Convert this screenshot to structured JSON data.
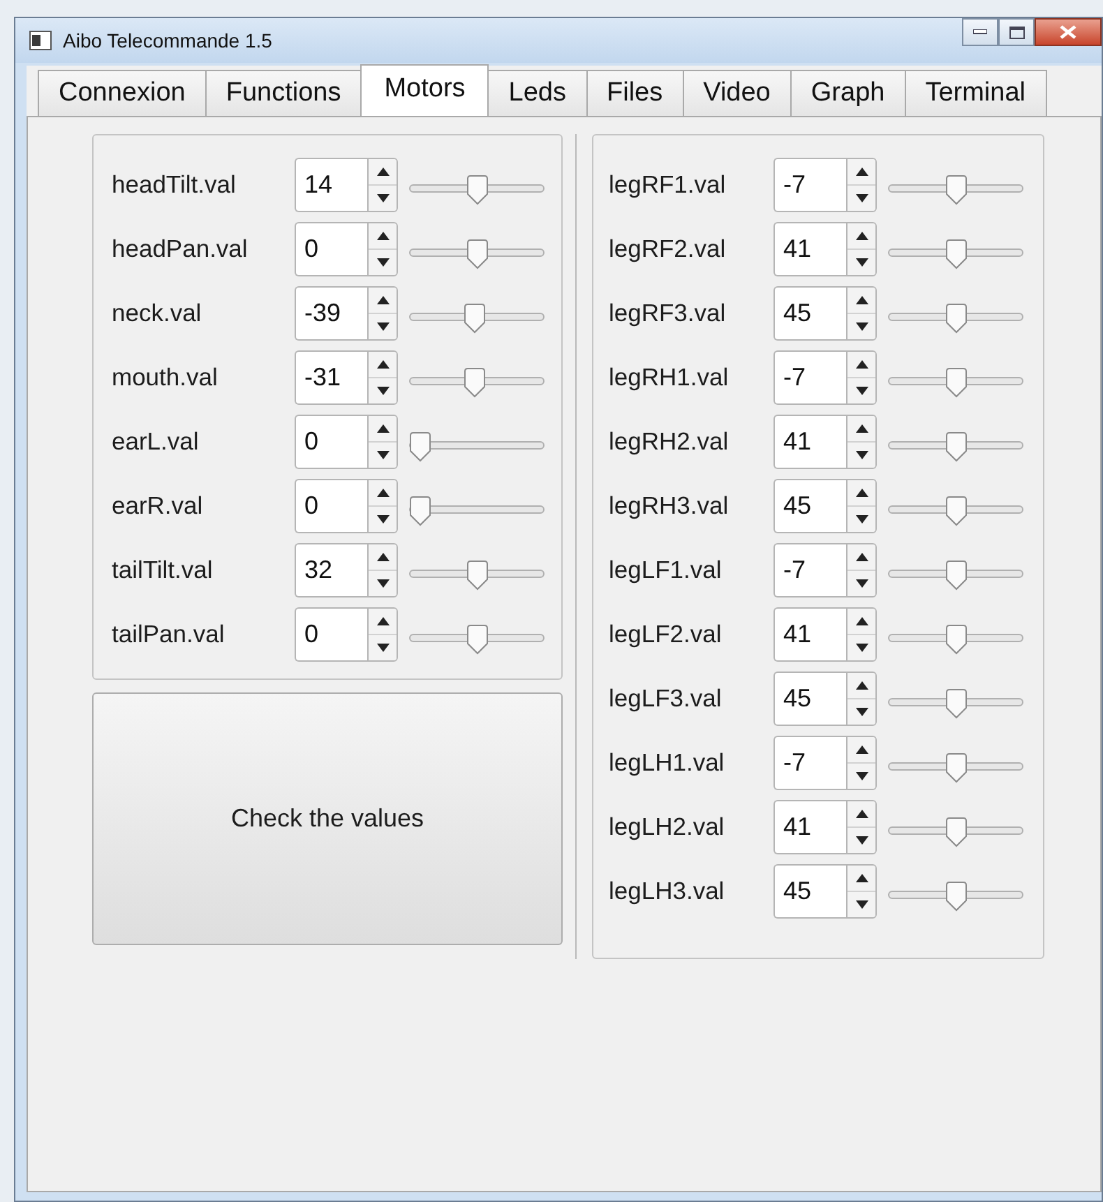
{
  "window": {
    "title": "Aibo Telecommande 1.5"
  },
  "tabs": [
    {
      "label": "Connexion",
      "selected": false
    },
    {
      "label": "Functions",
      "selected": false
    },
    {
      "label": "Motors",
      "selected": true
    },
    {
      "label": "Leds",
      "selected": false
    },
    {
      "label": "Files",
      "selected": false
    },
    {
      "label": "Video",
      "selected": false
    },
    {
      "label": "Graph",
      "selected": false
    },
    {
      "label": "Terminal",
      "selected": false
    }
  ],
  "head_motors": [
    {
      "label": "headTilt.val",
      "value": "14",
      "level": 0.5
    },
    {
      "label": "headPan.val",
      "value": "0",
      "level": 0.5
    },
    {
      "label": "neck.val",
      "value": "-39",
      "level": 0.48
    },
    {
      "label": "mouth.val",
      "value": "-31",
      "level": 0.48
    },
    {
      "label": "earL.val",
      "value": "0",
      "level": 0
    },
    {
      "label": "earR.val",
      "value": "0",
      "level": 0
    },
    {
      "label": "tailTilt.val",
      "value": "32",
      "level": 0.5
    },
    {
      "label": "tailPan.val",
      "value": "0",
      "level": 0.5
    }
  ],
  "check_button": {
    "label": "Check the values"
  },
  "leg_motors": [
    {
      "label": "legRF1.val",
      "value": "-7",
      "level": 0.5
    },
    {
      "label": "legRF2.val",
      "value": "41",
      "level": 0.5
    },
    {
      "label": "legRF3.val",
      "value": "45",
      "level": 0.5
    },
    {
      "label": "legRH1.val",
      "value": "-7",
      "level": 0.5
    },
    {
      "label": "legRH2.val",
      "value": "41",
      "level": 0.5
    },
    {
      "label": "legRH3.val",
      "value": "45",
      "level": 0.5
    },
    {
      "label": "legLF1.val",
      "value": "-7",
      "level": 0.5
    },
    {
      "label": "legLF2.val",
      "value": "41",
      "level": 0.5
    },
    {
      "label": "legLF3.val",
      "value": "45",
      "level": 0.5
    },
    {
      "label": "legLH1.val",
      "value": "-7",
      "level": 0.5
    },
    {
      "label": "legLH2.val",
      "value": "41",
      "level": 0.5
    },
    {
      "label": "legLH3.val",
      "value": "45",
      "level": 0.5
    }
  ]
}
